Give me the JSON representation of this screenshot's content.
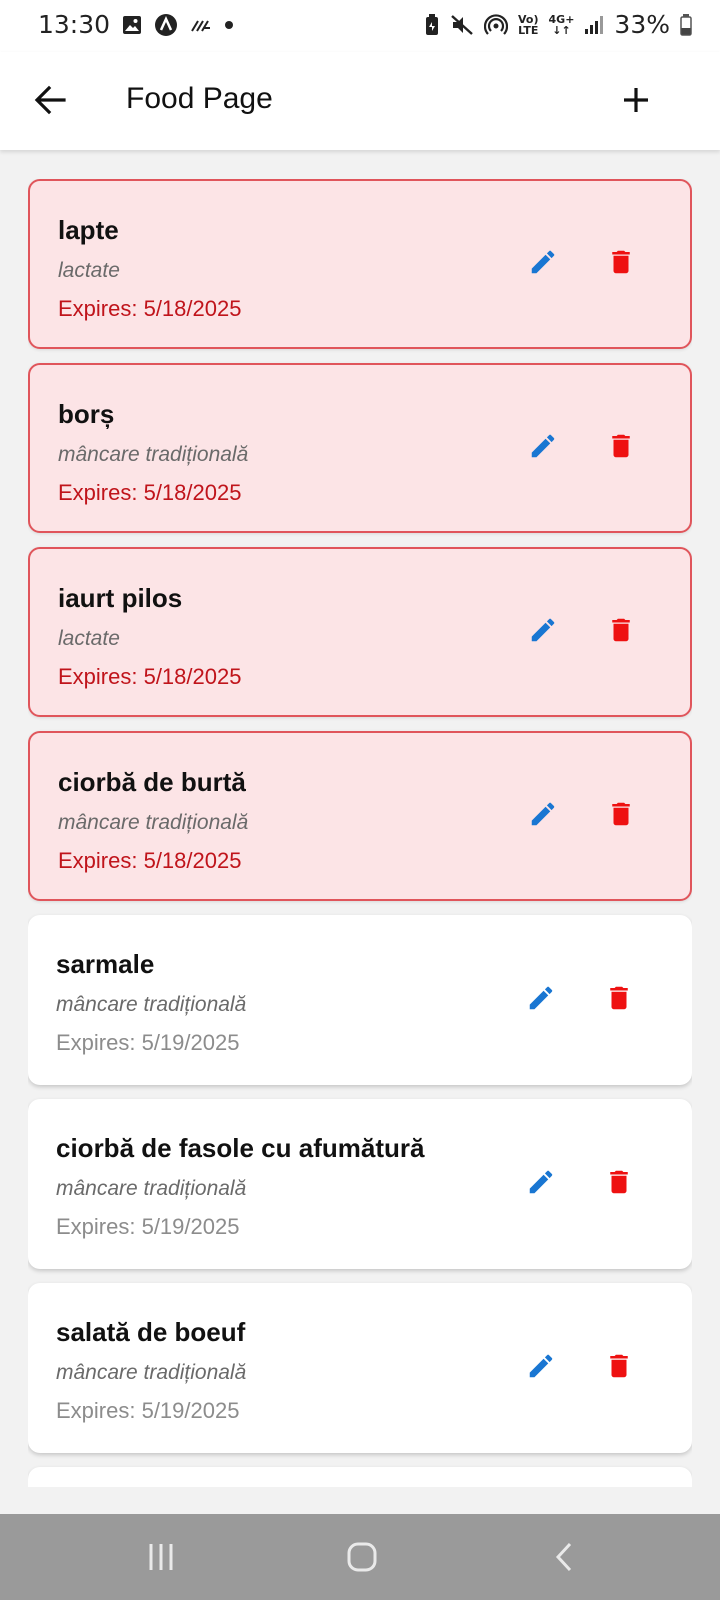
{
  "status_bar": {
    "time": "13:30",
    "battery": "33%",
    "icons_left": [
      "gallery-icon",
      "app-icon",
      "signal-app-icon",
      "dot-icon"
    ],
    "icons_right": [
      "battery-saver-icon",
      "mute-icon",
      "hotspot-icon",
      "volte-icon",
      "4g-icon",
      "signal-icon",
      "battery-icon"
    ],
    "volte_line1": "Vo)",
    "volte_line2": "LTE",
    "net_label": "4G+"
  },
  "appbar": {
    "title": "Food Page"
  },
  "colors": {
    "expired_bg": "#fce4e6",
    "expired_border": "#e0555b",
    "expired_text": "#c0141b",
    "edit_icon": "#1976d2",
    "delete_icon": "#ee1111"
  },
  "foods": [
    {
      "name": "lapte",
      "category": "lactate",
      "expires": "Expires: 5/18/2025",
      "expired": true
    },
    {
      "name": "borș",
      "category": "mâncare tradițională",
      "expires": "Expires: 5/18/2025",
      "expired": true
    },
    {
      "name": "iaurt pilos",
      "category": "lactate",
      "expires": "Expires: 5/18/2025",
      "expired": true
    },
    {
      "name": "ciorbă de burtă",
      "category": "mâncare tradițională",
      "expires": "Expires: 5/18/2025",
      "expired": true
    },
    {
      "name": "sarmale",
      "category": "mâncare tradițională",
      "expires": "Expires: 5/19/2025",
      "expired": false
    },
    {
      "name": "ciorbă de fasole cu afumătură",
      "category": "mâncare tradițională",
      "expires": "Expires: 5/19/2025",
      "expired": false
    },
    {
      "name": "salată de boeuf",
      "category": "mâncare tradițională",
      "expires": "Expires: 5/19/2025",
      "expired": false
    }
  ]
}
